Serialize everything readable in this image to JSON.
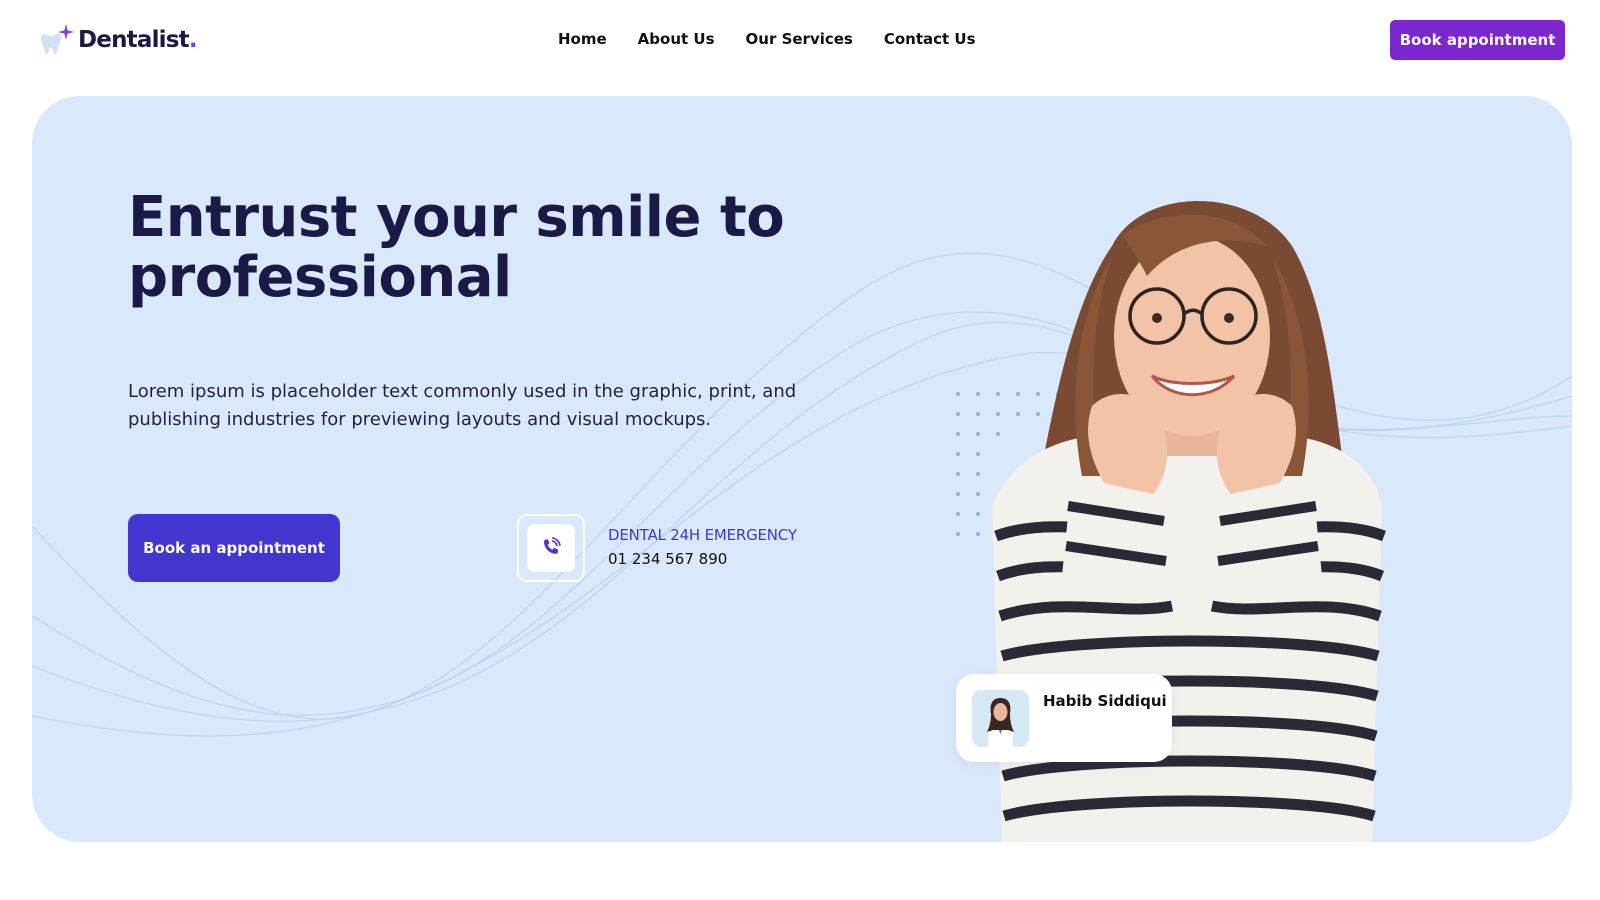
{
  "brand": {
    "name": "Dentalist",
    "dot": ".",
    "logo_icon": "tooth-sparkle-icon",
    "accent": "#7b26cf"
  },
  "nav": {
    "items": [
      "Home",
      "About Us",
      "Our Services",
      "Contact Us"
    ]
  },
  "header": {
    "cta_label": "Book appointment"
  },
  "hero": {
    "title_line1": "Entrust your smile to",
    "title_line2": "professional",
    "description": "Lorem ipsum is placeholder text commonly used in the graphic, print, and publishing industries for previewing layouts and visual mockups.",
    "cta_label": "Book an appointment",
    "background": "#dae8fc",
    "cta_color": "#4336cf"
  },
  "emergency": {
    "icon": "phone-ringing-icon",
    "title": "DENTAL 24H EMERGENCY",
    "phone": "01 234 567 890"
  },
  "doctor_card": {
    "name": "Habib Siddiqui",
    "avatar": "doctor-avatar"
  }
}
